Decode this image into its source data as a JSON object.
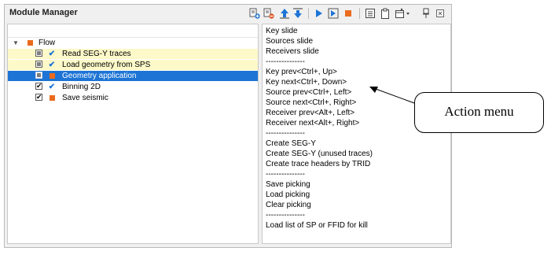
{
  "panel": {
    "title": "Module Manager"
  },
  "toolbar": {
    "icons": [
      "add-module-icon",
      "remove-module-icon",
      "move-up-icon",
      "move-down-icon",
      "run-icon",
      "run-step-icon",
      "stop-icon",
      "list-icon",
      "clipboard-icon",
      "window-dropdown-icon",
      "pin-icon",
      "close-icon"
    ]
  },
  "tree": {
    "root": {
      "label": "Flow",
      "expanded": true
    },
    "items": [
      {
        "label": "Read SEG-Y traces",
        "state": "partial",
        "status": "check",
        "highlight": true
      },
      {
        "label": "Load geometry from SPS",
        "state": "partial",
        "status": "check",
        "highlight": true
      },
      {
        "label": "Geometry application",
        "state": "partial",
        "status": "square",
        "selected": true
      },
      {
        "label": "Binning 2D",
        "state": "checked",
        "status": "check"
      },
      {
        "label": "Save seismic",
        "state": "checked",
        "status": "square"
      }
    ]
  },
  "action_menu": {
    "items": [
      "Key slide",
      "Sources slide",
      "Receivers slide",
      "---------------",
      "Key prev<Ctrl+, Up>",
      "Key next<Ctrl+, Down>",
      "Source prev<Ctrl+, Left>",
      "Source next<Ctrl+, Right>",
      "Receiver prev<Alt+, Left>",
      "Receiver next<Alt+, Right>",
      "---------------",
      "Create SEG-Y",
      "Create SEG-Y (unused traces)",
      "Create trace headers by TRID",
      "---------------",
      "Save picking",
      "Load picking",
      "Clear picking",
      "---------------",
      "Load list of SP or FFID for kill"
    ]
  },
  "callout": {
    "text": "Action menu"
  },
  "colors": {
    "accent": "#1d74d5",
    "highlight": "#fdf9c9",
    "module_square": "#ea6b1e"
  }
}
